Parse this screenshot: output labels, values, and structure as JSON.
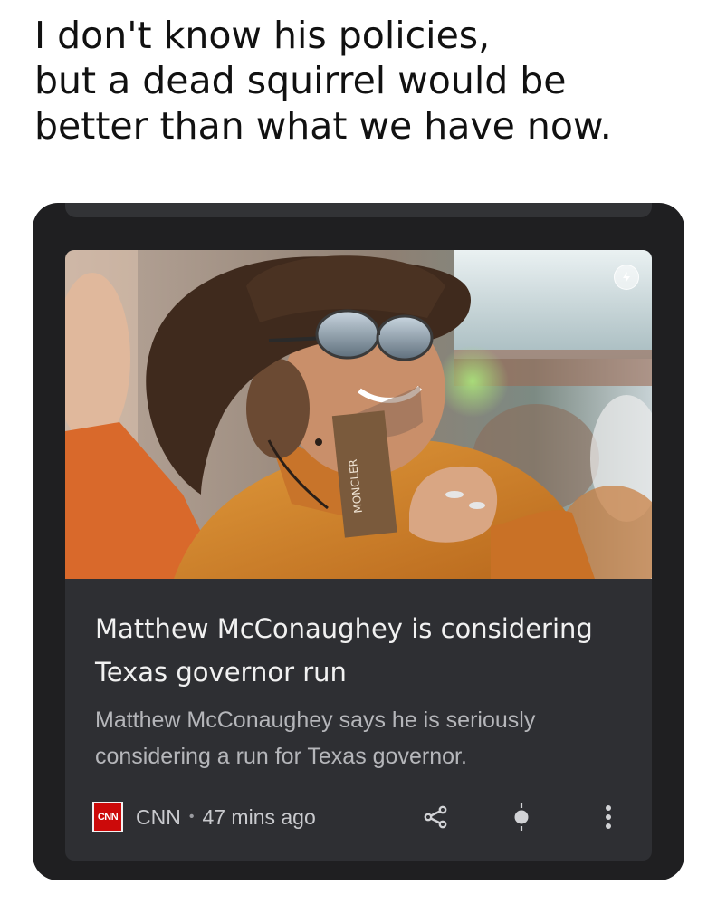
{
  "meme_caption": {
    "line1": "I don't know his policies,",
    "line2": "but a dead squirrel would be",
    "line3": "better than what we have now."
  },
  "news_card": {
    "image_caption_text": "MONCLER",
    "headline": "Matthew McConaughey is considering Texas governor run",
    "summary": "Matthew McConaughey says he is seriously considering a run for Texas governor.",
    "source": {
      "logo_text": "CNN",
      "name": "CNN",
      "separator": "•",
      "time": "47 mins ago"
    },
    "actions": [
      "share-icon",
      "follow-topic-icon",
      "more-options-icon"
    ],
    "amp_badge_icon": "lightning-bolt-icon"
  },
  "colors": {
    "card_background": "#2e2f33",
    "frame_background": "#1f1f21",
    "headline_text": "#f1f1f1",
    "summary_text": "#b5b6ba",
    "cnn_red": "#cc0a0a"
  }
}
